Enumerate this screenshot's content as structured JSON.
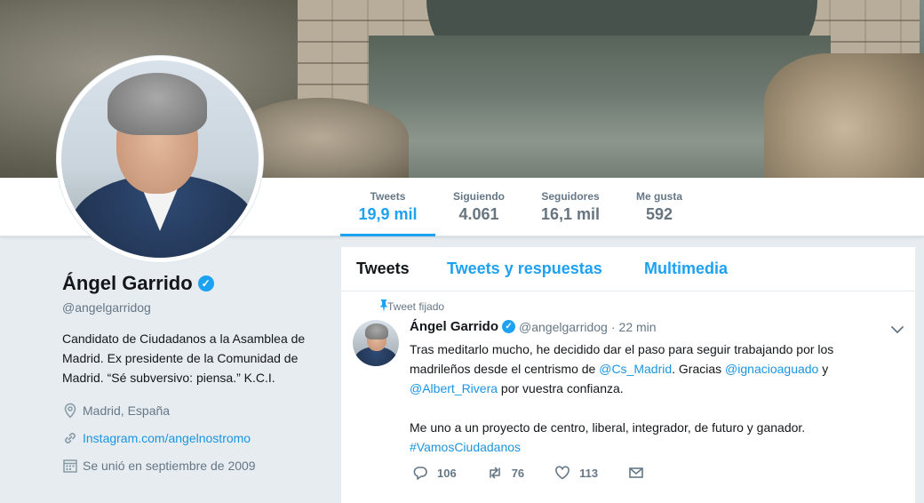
{
  "stats": {
    "tweets": {
      "label": "Tweets",
      "value": "19,9 mil"
    },
    "following": {
      "label": "Siguiendo",
      "value": "4.061"
    },
    "followers": {
      "label": "Seguidores",
      "value": "16,1 mil"
    },
    "likes": {
      "label": "Me gusta",
      "value": "592"
    }
  },
  "profile": {
    "name": "Ángel Garrido",
    "handle": "@angelgarridog",
    "bio": "Candidato de Ciudadanos a la Asamblea de Madrid. Ex presidente de la Comunidad de Madrid. “Sé subversivo: piensa.” K.C.I.",
    "location": "Madrid, España",
    "website": "Instagram.com/angelnostromo",
    "joined": "Se unió en septiembre de 2009"
  },
  "tabs": [
    "Tweets",
    "Tweets y respuestas",
    "Multimedia"
  ],
  "tweet": {
    "pinned_label": "Tweet fijado",
    "name": "Ángel Garrido",
    "handle": "@angelgarridog",
    "dot": "·",
    "time": "22 min",
    "p1_a": "Tras meditarlo mucho, he decidido dar el paso para seguir trabajando por los madrileños desde el centrismo de ",
    "p1_link1": "@Cs_Madrid",
    "p1_b": ". Gracias ",
    "p1_link2": "@ignacioaguado",
    "p1_c": " y ",
    "p1_link3": "@Albert_Rivera",
    "p1_d": " por vuestra confianza.",
    "p2": "Me uno a un proyecto de centro, liberal, integrador, de futuro y ganador.",
    "hashtag": "#VamosCiudadanos",
    "replies": "106",
    "retweets": "76",
    "likes": "113"
  },
  "icons": {
    "verified": "verified-badge-icon",
    "location": "map-pin-icon",
    "link": "link-icon",
    "calendar": "calendar-icon",
    "pin": "pin-icon",
    "reply": "reply-icon",
    "retweet": "retweet-icon",
    "like": "heart-icon",
    "dm": "envelope-icon",
    "caret": "chevron-down-icon"
  },
  "colors": {
    "accent": "#1da1f2",
    "link": "#1b95e0",
    "muted": "#657786",
    "background": "#e6ecf0"
  }
}
